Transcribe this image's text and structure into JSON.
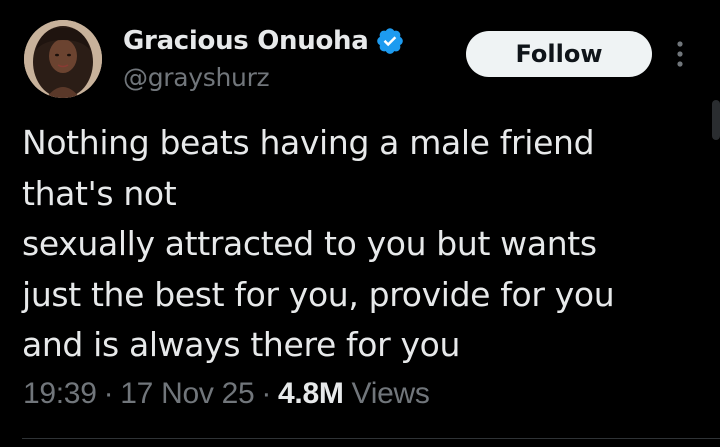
{
  "author": {
    "display_name": "Gracious Onuoha",
    "handle": "@grayshurz",
    "verified": true,
    "verified_color": "#1d9bf0"
  },
  "actions": {
    "follow_label": "Follow",
    "more_icon": "more-vertical-icon"
  },
  "tweet": {
    "lines": [
      "Nothing beats having a male friend",
      "that's not",
      "sexually attracted to you but wants",
      "just the best for you, provide for you",
      "and is always there for you"
    ]
  },
  "meta": {
    "time": "19:39",
    "separator": "·",
    "date": "17 Nov 25",
    "views_count": "4.8M",
    "views_label": "Views"
  },
  "colors": {
    "background": "#000000",
    "text_primary": "#e7e9ea",
    "text_secondary": "#71767b",
    "follow_bg": "#eff3f4",
    "follow_text": "#0f1419"
  }
}
